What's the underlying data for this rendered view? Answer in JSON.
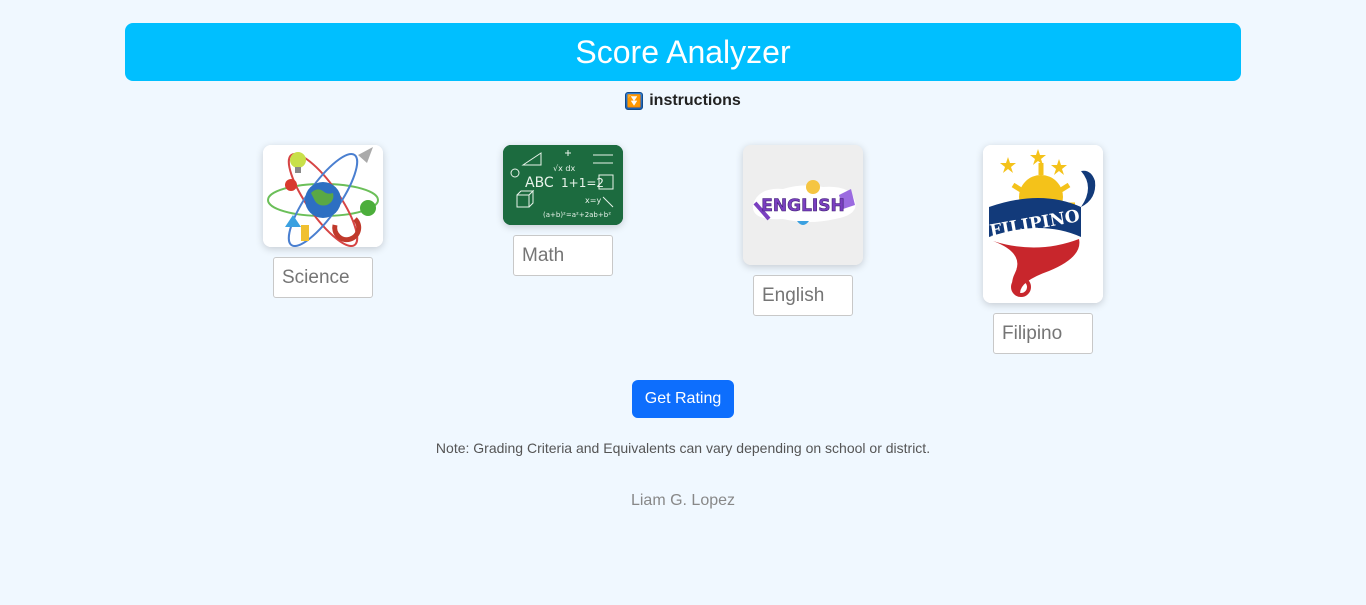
{
  "header": {
    "title": "Score Analyzer"
  },
  "instructions": {
    "icon": "down-arrow-button-icon",
    "label": "instructions"
  },
  "subjects": [
    {
      "key": "science",
      "image": "science-illustration",
      "placeholder": "Science"
    },
    {
      "key": "math",
      "image": "chalkboard-math-illustration",
      "placeholder": "Math"
    },
    {
      "key": "english",
      "image": "english-sticker-illustration",
      "image_text": "ENGLISH",
      "placeholder": "English"
    },
    {
      "key": "filipino",
      "image": "filipino-banner-illustration",
      "image_text": "FILIPINO",
      "placeholder": "Filipino"
    }
  ],
  "actions": {
    "get_rating_label": "Get Rating"
  },
  "note": "Note: Grading Criteria and Equivalents can vary depending on school or district.",
  "footer": {
    "author": "Liam G. Lopez"
  },
  "colors": {
    "header": "#00bfff",
    "button": "#0d6efd",
    "background": "#f0f8ff"
  }
}
